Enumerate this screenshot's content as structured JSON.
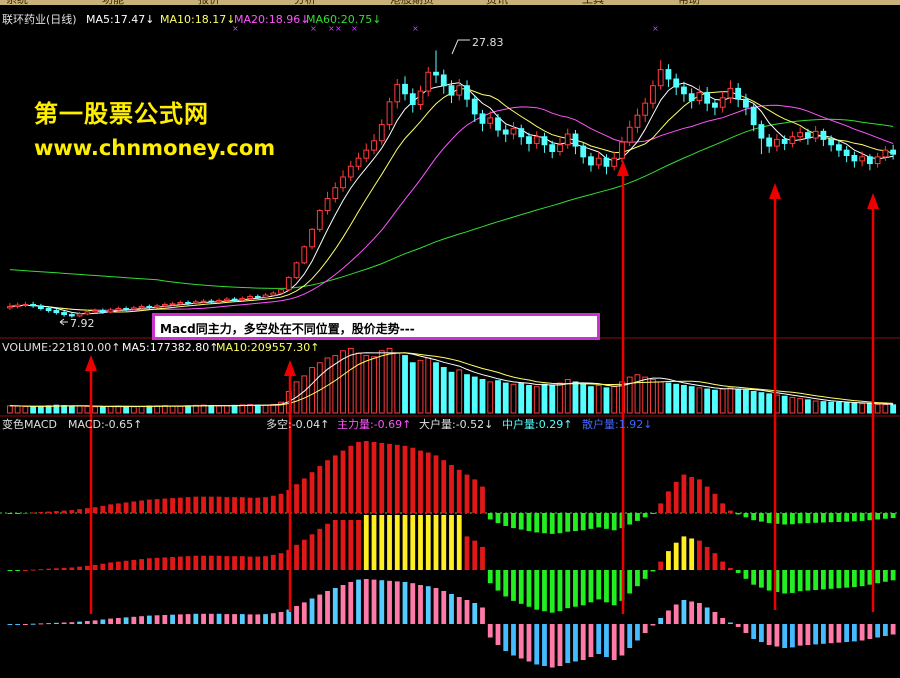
{
  "menu": [
    "系统",
    "功能",
    "报价",
    "分析",
    "港股期货",
    "资讯",
    "工具",
    "帮助"
  ],
  "colors": {
    "up": "#ff3b3b",
    "down": "#54ffff",
    "ma5": "#ffffff",
    "ma10": "#ffff66",
    "ma20": "#ff55ff",
    "ma60": "#33dd33",
    "watermark": "#ffee00",
    "arrow": "#ee0000"
  },
  "price_panel": {
    "header": [
      {
        "text": "联环药业(日线)",
        "color": "#e0e0e0"
      },
      {
        "text": "MA5:17.47↓",
        "color": "#ffffff"
      },
      {
        "text": "MA10:18.17↓",
        "color": "#ffff66"
      },
      {
        "text": "MA20:18.96↓",
        "color": "#ff55ff"
      },
      {
        "text": "MA60:20.75↓",
        "color": "#33dd33"
      }
    ],
    "high_label": "27.83",
    "low_label": "7.92"
  },
  "watermark": {
    "line1": "第一股票公式网",
    "line2": "www.chnmoney.com"
  },
  "annotation": "Macd同主力，多空处在不同位置，股价走势---",
  "volume_panel": {
    "header": [
      {
        "text": "VOLUME:221810.00↑",
        "color": "#e0e0e0"
      },
      {
        "text": "MA5:177382.80↑",
        "color": "#ffffff"
      },
      {
        "text": "MA10:209557.30↑",
        "color": "#ffff66"
      }
    ]
  },
  "macd_panel": {
    "header": [
      {
        "text": "变色MACD",
        "color": "#e0e0e0"
      },
      {
        "text": "MACD:-0.65↑",
        "color": "#e0e0e0"
      },
      {
        "text": "多空:-0.04↑",
        "color": "#e0e0e0"
      },
      {
        "text": "主力量:-0.69↑",
        "color": "#ff55ff"
      },
      {
        "text": "大户量:-0.52↓",
        "color": "#e0e0e0"
      },
      {
        "text": "中户量:0.29↑",
        "color": "#54ffff"
      },
      {
        "text": "散户量:1.92↓",
        "color": "#4466ff"
      }
    ]
  },
  "chart_data": [
    {
      "type": "candlestick",
      "title": "联环药业(日线)",
      "series": [
        {
          "name": "MA5",
          "last": 17.47
        },
        {
          "name": "MA10",
          "last": 18.17
        },
        {
          "name": "MA20",
          "last": 18.96
        },
        {
          "name": "MA60",
          "last": 20.75
        }
      ],
      "max_label": 27.83,
      "min_label": 7.92,
      "ylim": [
        7.0,
        29.5
      ],
      "candles": [
        [
          8.65,
          8.75,
          9.0,
          8.5
        ],
        [
          8.75,
          8.85,
          9.05,
          8.6
        ],
        [
          8.85,
          8.9,
          9.1,
          8.7
        ],
        [
          8.9,
          8.8,
          9.1,
          8.65
        ],
        [
          8.8,
          8.6,
          8.95,
          8.45
        ],
        [
          8.6,
          8.45,
          8.75,
          8.3
        ],
        [
          8.45,
          8.3,
          8.6,
          8.15
        ],
        [
          8.3,
          8.15,
          8.45,
          8.0
        ],
        [
          8.15,
          8.05,
          8.3,
          7.92
        ],
        [
          8.05,
          8.2,
          8.35,
          7.95
        ],
        [
          8.2,
          8.35,
          8.5,
          8.1
        ],
        [
          8.35,
          8.45,
          8.6,
          8.25
        ],
        [
          8.45,
          8.35,
          8.6,
          8.2
        ],
        [
          8.35,
          8.5,
          8.65,
          8.25
        ],
        [
          8.5,
          8.6,
          8.75,
          8.4
        ],
        [
          8.6,
          8.55,
          8.75,
          8.4
        ],
        [
          8.55,
          8.65,
          8.8,
          8.45
        ],
        [
          8.65,
          8.75,
          8.9,
          8.55
        ],
        [
          8.75,
          8.7,
          8.9,
          8.55
        ],
        [
          8.7,
          8.8,
          8.95,
          8.6
        ],
        [
          8.8,
          8.9,
          9.05,
          8.7
        ],
        [
          8.9,
          8.95,
          9.1,
          8.8
        ],
        [
          8.95,
          9.05,
          9.2,
          8.85
        ],
        [
          9.05,
          9.0,
          9.2,
          8.85
        ],
        [
          9.0,
          9.1,
          9.25,
          8.9
        ],
        [
          9.1,
          9.15,
          9.3,
          9.0
        ],
        [
          9.15,
          9.1,
          9.3,
          8.95
        ],
        [
          9.1,
          9.2,
          9.35,
          9.0
        ],
        [
          9.2,
          9.3,
          9.45,
          9.1
        ],
        [
          9.3,
          9.25,
          9.45,
          9.1
        ],
        [
          9.25,
          9.35,
          9.5,
          9.15
        ],
        [
          9.35,
          9.5,
          9.65,
          9.25
        ],
        [
          9.5,
          9.45,
          9.65,
          9.3
        ],
        [
          9.45,
          9.6,
          9.75,
          9.35
        ],
        [
          9.6,
          9.75,
          9.9,
          9.5
        ],
        [
          9.75,
          10.0,
          10.1,
          9.65
        ],
        [
          10.0,
          10.9,
          11.0,
          9.9
        ],
        [
          10.9,
          12.0,
          12.1,
          10.8
        ],
        [
          12.0,
          13.2,
          13.3,
          11.9
        ],
        [
          13.2,
          14.5,
          14.6,
          13.0
        ],
        [
          14.5,
          15.9,
          16.0,
          14.3
        ],
        [
          15.9,
          16.8,
          17.3,
          15.6
        ],
        [
          16.8,
          17.6,
          18.0,
          16.5
        ],
        [
          17.6,
          18.4,
          18.9,
          17.3
        ],
        [
          18.4,
          19.2,
          19.6,
          18.1
        ],
        [
          19.2,
          19.8,
          20.2,
          18.9
        ],
        [
          19.8,
          20.4,
          20.9,
          19.5
        ],
        [
          20.4,
          21.1,
          21.6,
          20.1
        ],
        [
          21.1,
          22.3,
          22.7,
          20.8
        ],
        [
          22.3,
          24.0,
          24.3,
          21.9
        ],
        [
          24.0,
          25.3,
          25.7,
          23.5
        ],
        [
          25.3,
          24.6,
          25.9,
          24.1
        ],
        [
          24.6,
          23.8,
          25.0,
          23.2
        ],
        [
          23.8,
          24.8,
          25.2,
          23.4
        ],
        [
          24.8,
          26.2,
          26.6,
          24.4
        ],
        [
          26.2,
          26.0,
          27.83,
          25.4
        ],
        [
          26.0,
          25.2,
          26.4,
          24.6
        ],
        [
          25.2,
          24.5,
          25.6,
          23.9
        ],
        [
          24.5,
          25.2,
          25.7,
          24.1
        ],
        [
          25.2,
          24.2,
          25.6,
          23.6
        ],
        [
          24.2,
          23.1,
          24.5,
          22.5
        ],
        [
          23.1,
          22.4,
          23.4,
          21.8
        ],
        [
          22.4,
          22.8,
          23.3,
          22.0
        ],
        [
          22.8,
          21.9,
          23.1,
          21.4
        ],
        [
          21.9,
          21.6,
          22.3,
          21.0
        ],
        [
          21.6,
          22.0,
          22.5,
          21.2
        ],
        [
          22.0,
          21.4,
          22.3,
          20.8
        ],
        [
          21.4,
          20.9,
          21.7,
          20.3
        ],
        [
          20.9,
          21.4,
          21.8,
          20.5
        ],
        [
          21.4,
          20.8,
          21.7,
          20.2
        ],
        [
          20.8,
          20.3,
          21.1,
          19.8
        ],
        [
          20.3,
          20.8,
          21.3,
          20.0
        ],
        [
          20.8,
          21.6,
          22.0,
          20.5
        ],
        [
          21.6,
          20.7,
          21.9,
          20.1
        ],
        [
          20.7,
          19.9,
          21.0,
          19.4
        ],
        [
          19.9,
          19.3,
          20.2,
          18.8
        ],
        [
          19.3,
          19.8,
          20.3,
          19.0
        ],
        [
          19.8,
          19.2,
          20.1,
          18.6
        ],
        [
          19.2,
          19.8,
          20.3,
          18.9
        ],
        [
          19.8,
          21.0,
          21.4,
          19.5
        ],
        [
          21.0,
          22.1,
          22.6,
          20.7
        ],
        [
          22.1,
          23.0,
          23.5,
          21.7
        ],
        [
          23.0,
          23.9,
          24.3,
          22.5
        ],
        [
          23.9,
          25.2,
          25.6,
          23.5
        ],
        [
          25.2,
          26.4,
          27.1,
          24.9
        ],
        [
          26.4,
          25.7,
          26.8,
          25.1
        ],
        [
          25.7,
          25.1,
          26.1,
          24.5
        ],
        [
          25.1,
          24.6,
          25.5,
          24.0
        ],
        [
          24.6,
          24.1,
          25.0,
          23.5
        ],
        [
          24.1,
          24.7,
          25.2,
          23.8
        ],
        [
          24.7,
          23.9,
          25.1,
          23.3
        ],
        [
          23.9,
          23.6,
          24.2,
          23.0
        ],
        [
          23.6,
          24.3,
          24.8,
          23.2
        ],
        [
          24.3,
          25.0,
          25.6,
          23.9
        ],
        [
          25.0,
          24.2,
          25.4,
          23.6
        ],
        [
          24.2,
          23.6,
          24.6,
          23.0
        ],
        [
          23.6,
          22.3,
          23.9,
          21.8
        ],
        [
          22.3,
          21.3,
          22.6,
          20.1
        ],
        [
          21.3,
          20.7,
          21.6,
          20.2
        ],
        [
          20.7,
          21.2,
          21.6,
          20.3
        ],
        [
          21.2,
          20.9,
          21.5,
          20.4
        ],
        [
          20.9,
          21.4,
          21.8,
          20.6
        ],
        [
          21.4,
          21.7,
          22.1,
          21.0
        ],
        [
          21.7,
          21.3,
          22.0,
          20.8
        ],
        [
          21.3,
          21.8,
          22.2,
          21.0
        ],
        [
          21.8,
          21.2,
          22.0,
          20.7
        ],
        [
          21.2,
          20.8,
          21.5,
          20.3
        ],
        [
          20.8,
          20.4,
          21.1,
          19.9
        ],
        [
          20.4,
          20.0,
          20.7,
          19.5
        ],
        [
          20.0,
          19.6,
          20.3,
          19.1
        ],
        [
          19.6,
          19.9,
          20.3,
          19.2
        ],
        [
          19.9,
          19.4,
          20.1,
          18.9
        ],
        [
          19.4,
          19.9,
          20.2,
          19.1
        ],
        [
          19.9,
          20.4,
          20.7,
          19.6
        ],
        [
          20.4,
          20.1,
          20.8,
          19.7
        ]
      ]
    },
    {
      "type": "bar",
      "title": "VOLUME",
      "series": [
        {
          "name": "VOLUME",
          "last": 221810.0
        },
        {
          "name": "MA5",
          "last": 177382.8
        },
        {
          "name": "MA10",
          "last": 209557.3
        }
      ],
      "ylim": [
        0,
        560000
      ],
      "values": [
        60000,
        58000,
        55000,
        52000,
        56000,
        60000,
        65000,
        62000,
        58000,
        60000,
        55000,
        52000,
        50000,
        54000,
        58000,
        56000,
        52000,
        55000,
        58000,
        60000,
        62000,
        58000,
        56000,
        60000,
        64000,
        66000,
        62000,
        58000,
        60000,
        64000,
        68000,
        70000,
        66000,
        64000,
        72000,
        90000,
        180000,
        260000,
        310000,
        380000,
        420000,
        460000,
        480000,
        520000,
        540000,
        500000,
        480000,
        470000,
        520000,
        540000,
        500000,
        480000,
        420000,
        440000,
        460000,
        420000,
        380000,
        340000,
        360000,
        320000,
        300000,
        280000,
        260000,
        270000,
        250000,
        240000,
        250000,
        230000,
        220000,
        240000,
        230000,
        250000,
        280000,
        260000,
        240000,
        220000,
        230000,
        210000,
        220000,
        260000,
        300000,
        320000,
        300000,
        280000,
        260000,
        250000,
        240000,
        230000,
        220000,
        210000,
        200000,
        190000,
        200000,
        210000,
        200000,
        190000,
        180000,
        170000,
        160000,
        150000,
        140000,
        130000,
        120000,
        110000,
        100000,
        95000,
        90000,
        88000,
        85000,
        80000,
        78000,
        75000,
        72000,
        70000,
        68000
      ]
    },
    {
      "type": "bar",
      "title": "变色MACD",
      "series": [
        {
          "name": "MACD",
          "last": -0.65
        },
        {
          "name": "多空",
          "last": -0.04
        },
        {
          "name": "主力量",
          "last": -0.69
        },
        {
          "name": "大户量",
          "last": -0.52
        },
        {
          "name": "中户量",
          "last": 0.29
        },
        {
          "name": "散户量",
          "last": 1.92
        }
      ],
      "ylim": [
        -2.0,
        1.5
      ],
      "macd": [
        -0.02,
        -0.01,
        0.0,
        0.01,
        0.02,
        0.03,
        0.04,
        0.05,
        0.06,
        0.08,
        0.1,
        0.12,
        0.15,
        0.18,
        0.2,
        0.22,
        0.24,
        0.26,
        0.28,
        0.29,
        0.3,
        0.31,
        0.32,
        0.33,
        0.34,
        0.34,
        0.34,
        0.34,
        0.33,
        0.33,
        0.33,
        0.32,
        0.32,
        0.33,
        0.36,
        0.4,
        0.48,
        0.6,
        0.72,
        0.85,
        0.98,
        1.1,
        1.2,
        1.3,
        1.4,
        1.48,
        1.5,
        1.48,
        1.46,
        1.44,
        1.42,
        1.4,
        1.36,
        1.3,
        1.26,
        1.2,
        1.1,
        1.0,
        0.9,
        0.8,
        0.7,
        0.55,
        -0.45,
        -0.7,
        -0.9,
        -1.05,
        -1.15,
        -1.25,
        -1.35,
        -1.4,
        -1.45,
        -1.4,
        -1.3,
        -1.25,
        -1.2,
        -1.1,
        -1.0,
        -1.1,
        -1.2,
        -1.05,
        -0.8,
        -0.55,
        -0.3,
        -0.05,
        0.2,
        0.45,
        0.65,
        0.8,
        0.75,
        0.7,
        0.55,
        0.4,
        0.2,
        0.05,
        -0.1,
        -0.3,
        -0.5,
        -0.6,
        -0.7,
        -0.75,
        -0.8,
        -0.78,
        -0.72,
        -0.7,
        -0.68,
        -0.66,
        -0.64,
        -0.62,
        -0.6,
        -0.58,
        -0.55,
        -0.5,
        -0.45,
        -0.4,
        -0.35
      ]
    }
  ]
}
